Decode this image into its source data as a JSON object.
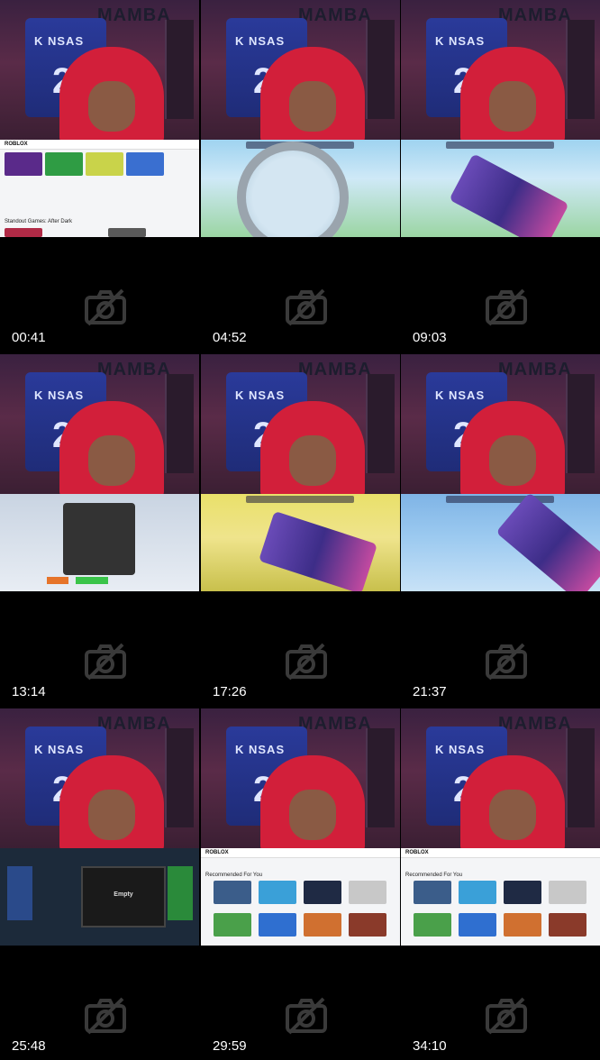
{
  "thumbnails": [
    {
      "time": "00:41",
      "screen": "roblox-home",
      "title": "Standout Games: After Dark"
    },
    {
      "time": "04:52",
      "screen": "fps-scope",
      "title": ""
    },
    {
      "time": "09:03",
      "screen": "fps-green",
      "title": ""
    },
    {
      "time": "13:14",
      "screen": "menu",
      "title": ""
    },
    {
      "time": "17:26",
      "screen": "fps-yellow",
      "title": ""
    },
    {
      "time": "21:37",
      "screen": "fps-blue",
      "title": ""
    },
    {
      "time": "25:48",
      "screen": "inventory",
      "title": "Empty"
    },
    {
      "time": "29:59",
      "screen": "roblox-rec",
      "title": "Recommended For You"
    },
    {
      "time": "34:10",
      "screen": "roblox-rec",
      "title": "Recommended For You"
    }
  ],
  "webcam": {
    "poster_text": "K NSAS",
    "poster_number": "2",
    "wall_text": "MAMBA"
  },
  "roblox": {
    "logo": "ROBLOX"
  },
  "icon": "camera-off-icon"
}
